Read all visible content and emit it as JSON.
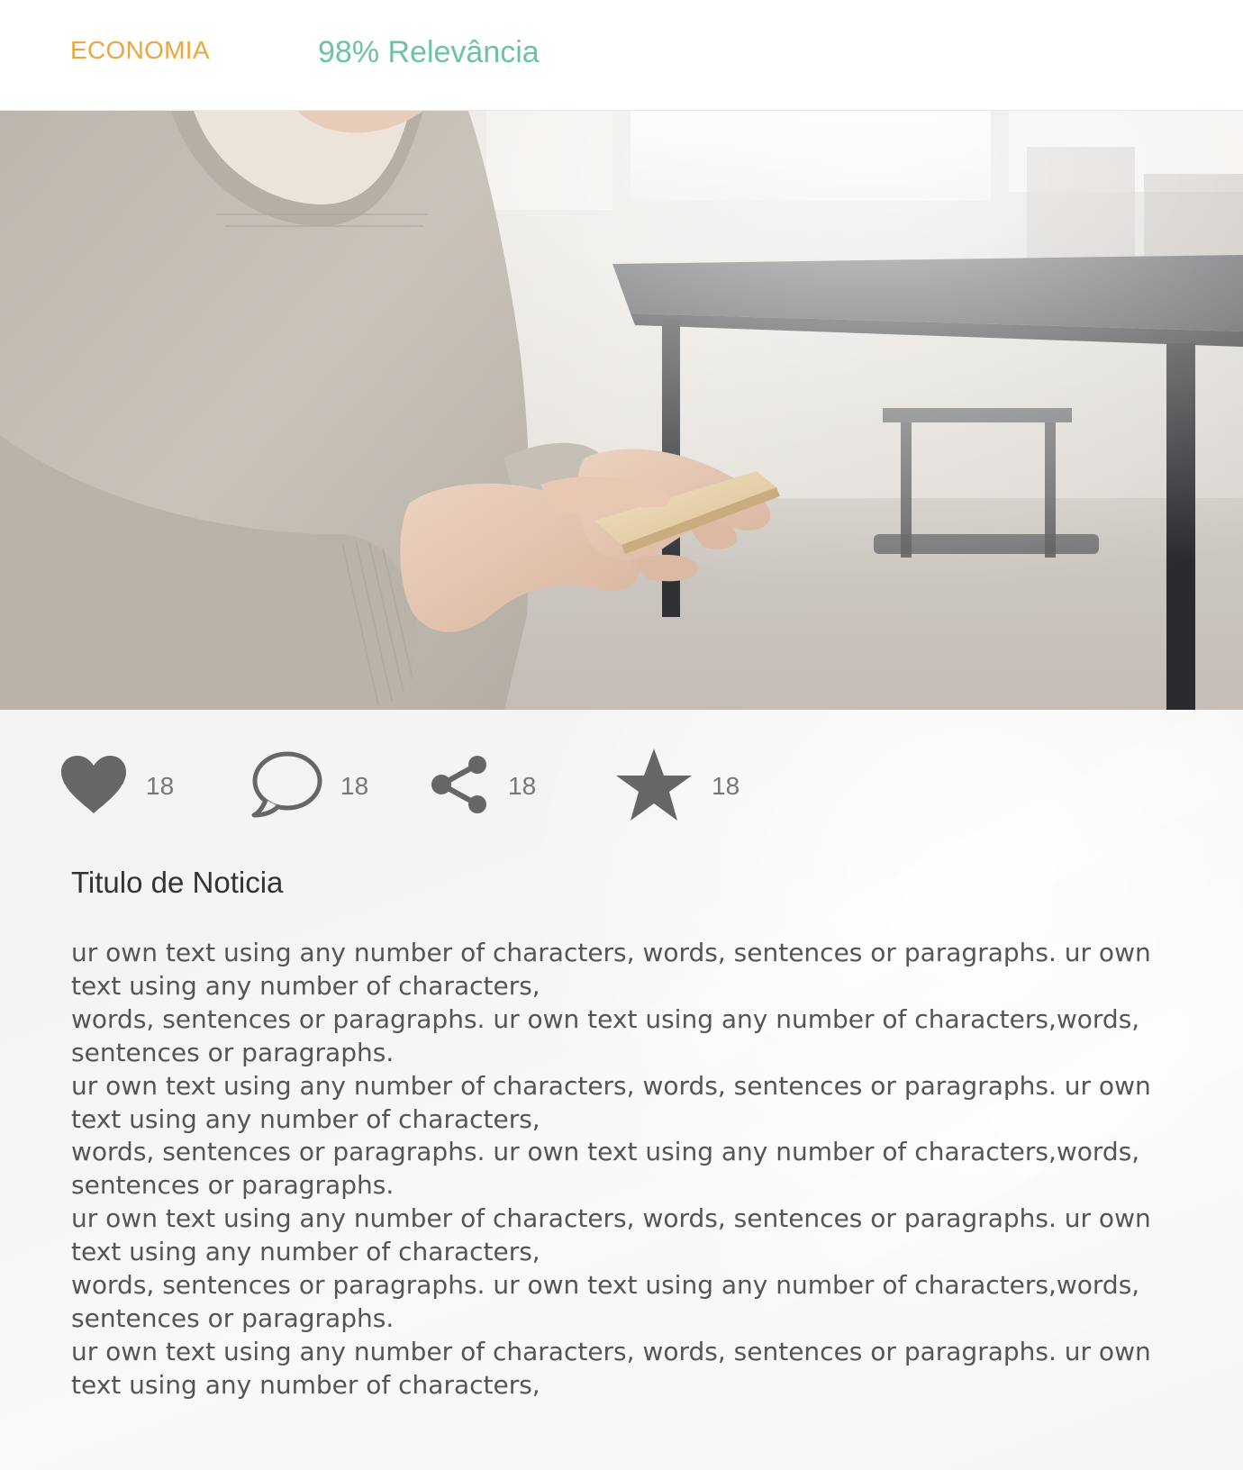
{
  "header": {
    "category": "ECONOMIA",
    "relevance": "98% Relevância"
  },
  "colors": {
    "category": "#e7a93f",
    "relevance": "#6cc3a4",
    "icon": "#666666",
    "count": "#777777"
  },
  "hero_image": {
    "description_icon": "photo-person-holding-phone"
  },
  "actions": {
    "like": {
      "icon": "heart-icon",
      "count": "18"
    },
    "comment": {
      "icon": "speech-bubble-icon",
      "count": "18"
    },
    "share": {
      "icon": "share-icon",
      "count": "18"
    },
    "favorite": {
      "icon": "star-icon",
      "count": "18"
    }
  },
  "article": {
    "title": "Titulo de Noticia",
    "lines": [
      "ur own text using any number of characters, words, sentences or paragraphs. ur own text using any number of characters,",
      "words, sentences or paragraphs. ur own text using any number of characters,words, sentences or paragraphs.",
      "ur own text using any number of characters, words, sentences or paragraphs. ur own text using any number of characters,",
      "words, sentences or paragraphs. ur own text using any number of characters,words, sentences or paragraphs.",
      "ur own text using any number of characters, words, sentences or paragraphs. ur own text using any number of characters,",
      "words, sentences or paragraphs. ur own text using any number of characters,words, sentences or paragraphs.",
      "ur own text using any number of characters, words, sentences or paragraphs. ur own text using any number of characters,"
    ]
  }
}
